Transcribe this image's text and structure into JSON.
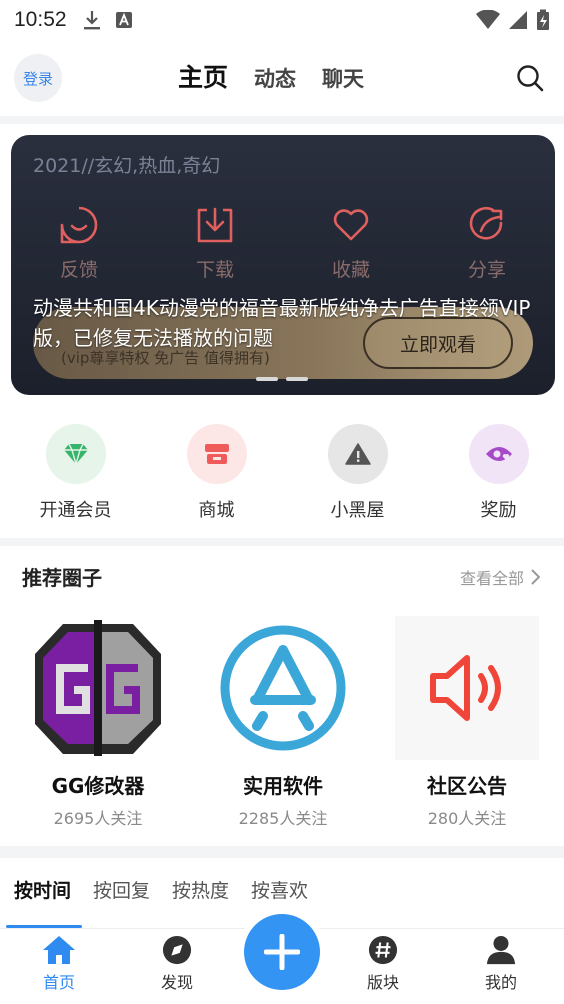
{
  "status_bar": {
    "time": "10:52"
  },
  "header": {
    "login_label": "登录",
    "tabs": [
      {
        "label": "主页",
        "active": true
      },
      {
        "label": "动态",
        "active": false
      },
      {
        "label": "聊天",
        "active": false
      }
    ],
    "search_icon": "search-icon"
  },
  "banner": {
    "tags": "2021//玄幻,热血,奇幻",
    "actions": [
      {
        "label": "反馈",
        "icon": "smile-icon"
      },
      {
        "label": "下载",
        "icon": "download-icon"
      },
      {
        "label": "收藏",
        "icon": "heart-icon"
      },
      {
        "label": "分享",
        "icon": "share-icon"
      }
    ],
    "vip_sub": "(vip尊享特权 免广告 值得拥有)",
    "watch_label": "立即观看",
    "caption": "动漫共和国4K动漫党的福音最新版纯净去广告直接领VIP版，已修复无法播放的问题",
    "accent": "#e0605f"
  },
  "quick_entries": [
    {
      "label": "开通会员",
      "icon": "diamond-icon",
      "bg": "#e6f4ea",
      "color": "#35b46a"
    },
    {
      "label": "商城",
      "icon": "shop-icon",
      "bg": "#fde6e6",
      "color": "#ef5b5b"
    },
    {
      "label": "小黑屋",
      "icon": "warning-icon",
      "bg": "#e6e6e6",
      "color": "#555555"
    },
    {
      "label": "奖励",
      "icon": "eye-heart-icon",
      "bg": "#f1e4f6",
      "color": "#a64ac9"
    }
  ],
  "recommended": {
    "title": "推荐圈子",
    "view_all": "查看全部",
    "items": [
      {
        "name": "GG修改器",
        "followers": "2695人关注",
        "icon": "gg-logo"
      },
      {
        "name": "实用软件",
        "followers": "2285人关注",
        "icon": "appstore-logo"
      },
      {
        "name": "社区公告",
        "followers": "280人关注",
        "icon": "speaker-icon"
      }
    ]
  },
  "sort_tabs": [
    {
      "label": "按时间",
      "active": true
    },
    {
      "label": "按回复",
      "active": false
    },
    {
      "label": "按热度",
      "active": false
    },
    {
      "label": "按喜欢",
      "active": false
    }
  ],
  "bottom_nav": [
    {
      "label": "首页",
      "icon": "home-icon",
      "active": true
    },
    {
      "label": "发现",
      "icon": "compass-icon",
      "active": false
    },
    {
      "label": "版块",
      "icon": "hashtag-icon",
      "active": false
    },
    {
      "label": "我的",
      "icon": "user-icon",
      "active": false
    }
  ],
  "colors": {
    "primary": "#3494f4",
    "text": "#222222"
  }
}
